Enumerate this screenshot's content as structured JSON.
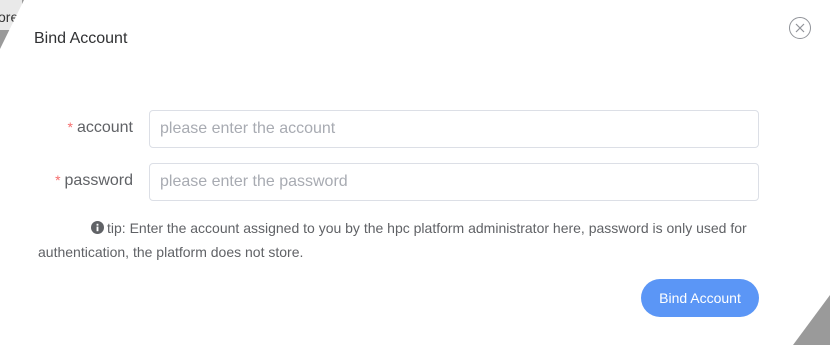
{
  "background": {
    "partial_text": "ore"
  },
  "dialog": {
    "title": "Bind Account",
    "close_icon": "close-icon",
    "fields": {
      "account": {
        "required_mark": "*",
        "label": "account",
        "placeholder": "please enter the account",
        "value": ""
      },
      "password": {
        "required_mark": "*",
        "label": "password",
        "placeholder": "please enter the password",
        "value": ""
      }
    },
    "tip": {
      "icon": "info-circle-icon",
      "text": "tip: Enter the account assigned to you by the hpc platform administrator here, password is only used for authentication, the platform does not store."
    },
    "submit_label": "Bind Account"
  },
  "colors": {
    "primary": "#5b96f6",
    "required": "#f56c6c",
    "text": "#606266",
    "border": "#dcdfe6"
  }
}
